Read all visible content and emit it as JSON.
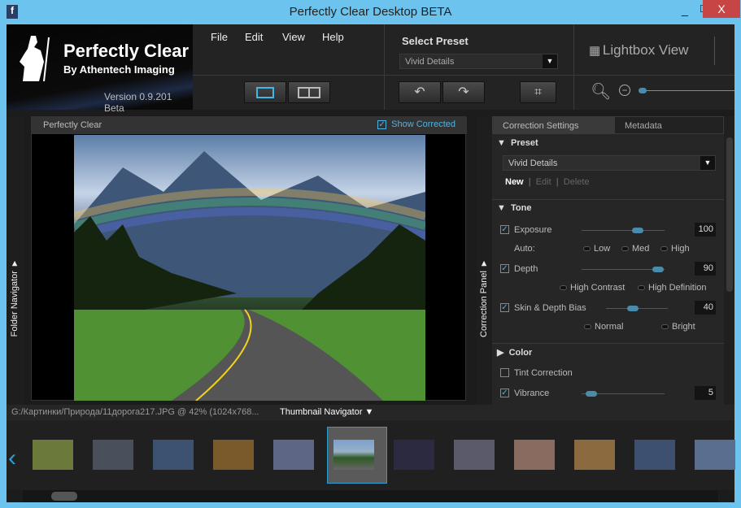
{
  "window": {
    "title": "Perfectly Clear Desktop BETA",
    "minimize": "_",
    "maximize": "☐",
    "close": "X"
  },
  "logo": {
    "name": "Perfectly Clear",
    "sub": "By Athentech Imaging",
    "version": "Version 0.9.201 Beta"
  },
  "menu": [
    "File",
    "Edit",
    "View",
    "Help"
  ],
  "preset": {
    "label": "Select Preset",
    "value": "Vivid Details"
  },
  "lightbox": {
    "label": "Lightbox View"
  },
  "toolbar": {
    "zoom_level": 0.05
  },
  "left_strip": {
    "label": "Folder Navigator ▼"
  },
  "right_strip": {
    "label": "Correction Panel ▼"
  },
  "image_panel": {
    "title": "Perfectly Clear",
    "show_corrected": "Show Corrected",
    "show_corrected_checked": true
  },
  "correction": {
    "tabs": [
      "Correction Settings",
      "Metadata"
    ],
    "preset": {
      "header": "Preset",
      "value": "Vivid Details",
      "actions": [
        "New",
        "Edit",
        "Delete"
      ]
    },
    "tone": {
      "header": "Tone",
      "exposure": {
        "label": "Exposure",
        "value": "100",
        "checked": true,
        "level": 0.65
      },
      "auto_label": "Auto:",
      "auto_options": [
        "Low",
        "Med",
        "High"
      ],
      "depth": {
        "label": "Depth",
        "value": "90",
        "checked": true,
        "level": 0.9
      },
      "depth_options": [
        "High Contrast",
        "High Definition"
      ],
      "skin": {
        "label": "Skin & Depth Bias",
        "value": "40",
        "checked": true,
        "level": 0.4
      },
      "skin_options": [
        "Normal",
        "Bright"
      ]
    },
    "color": {
      "header": "Color",
      "tint": {
        "label": "Tint Correction",
        "checked": false
      },
      "vibrance": {
        "label": "Vibrance",
        "value": "5",
        "checked": true,
        "level": 0.1
      }
    }
  },
  "status": {
    "path": "G:/Картинки/Природа/11дорога217.JPG @ 42% (1024x768...",
    "navigator": "Thumbnail Navigator ▼"
  },
  "thumbnails": {
    "count": 12,
    "selected": 5
  }
}
